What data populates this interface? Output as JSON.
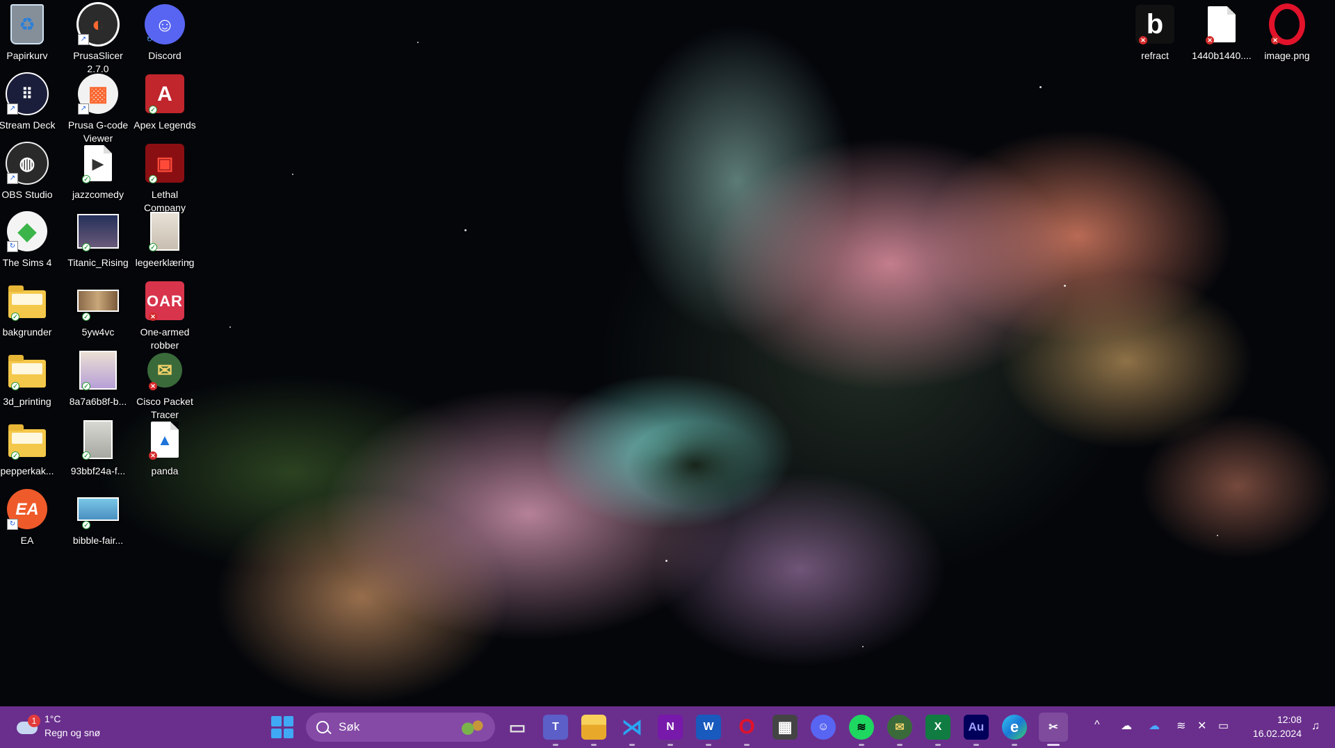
{
  "desktop_icons": {
    "papirkurv": "Papirkurv",
    "prusaslicer": "PrusaSlicer 2.7.0",
    "discord": "Discord",
    "streamdeck": "Stream Deck",
    "prusa_gcode": "Prusa G-code Viewer",
    "apex": "Apex Legends",
    "obs": "OBS Studio",
    "jazzcomedy": "jazzcomedy",
    "lethal": "Lethal Company",
    "sims": "The Sims 4",
    "titanic": "Titanic_Rising",
    "legeerklaering": "legeerklæring",
    "bakgrunder": "bakgrunder",
    "5yw4vc": "5yw4vc",
    "onearmed": "One-armed robber",
    "3dprinting": "3d_printing",
    "8a7a6b8f": "8a7a6b8f-b...",
    "cisco": "Cisco Packet Tracer",
    "pepperkak": "pepperkak...",
    "93bbf24a": "93bbf24a-f...",
    "panda": "panda",
    "ea": "EA",
    "bibble": "bibble-fair...",
    "refract": "refract",
    "file1440": "1440b1440....",
    "imagepng": "image.png"
  },
  "icon_glyphs": {
    "ea": "EA",
    "onearmed": "OAR",
    "refract": "b",
    "apex": "A",
    "opera": "O"
  },
  "taskbar": {
    "weather_temp": "1°C",
    "weather_desc": "Regn og snø",
    "weather_badge": "1",
    "search_placeholder": "Søk",
    "apps": [
      {
        "name": "task-view",
        "glyph": "▭"
      },
      {
        "name": "teams",
        "glyph": "T"
      },
      {
        "name": "file-explorer",
        "glyph": ""
      },
      {
        "name": "visual-studio",
        "glyph": "⋊"
      },
      {
        "name": "onenote",
        "glyph": "N"
      },
      {
        "name": "word",
        "glyph": "W"
      },
      {
        "name": "opera",
        "glyph": "O"
      },
      {
        "name": "calculator",
        "glyph": "▦"
      },
      {
        "name": "discord",
        "glyph": "☺"
      },
      {
        "name": "spotify",
        "glyph": "≋"
      },
      {
        "name": "cisco-packet-tracer",
        "glyph": "✉"
      },
      {
        "name": "excel",
        "glyph": "X"
      },
      {
        "name": "audition",
        "glyph": "Au"
      },
      {
        "name": "edge",
        "glyph": "e"
      },
      {
        "name": "snipping-tool",
        "glyph": "✂"
      }
    ],
    "time": "12:08",
    "date": "16.02.2024"
  },
  "colors": {
    "taskbar": "#6a2f8d",
    "search_box": "#844aa6",
    "start_blue": "#3fa9f5"
  }
}
